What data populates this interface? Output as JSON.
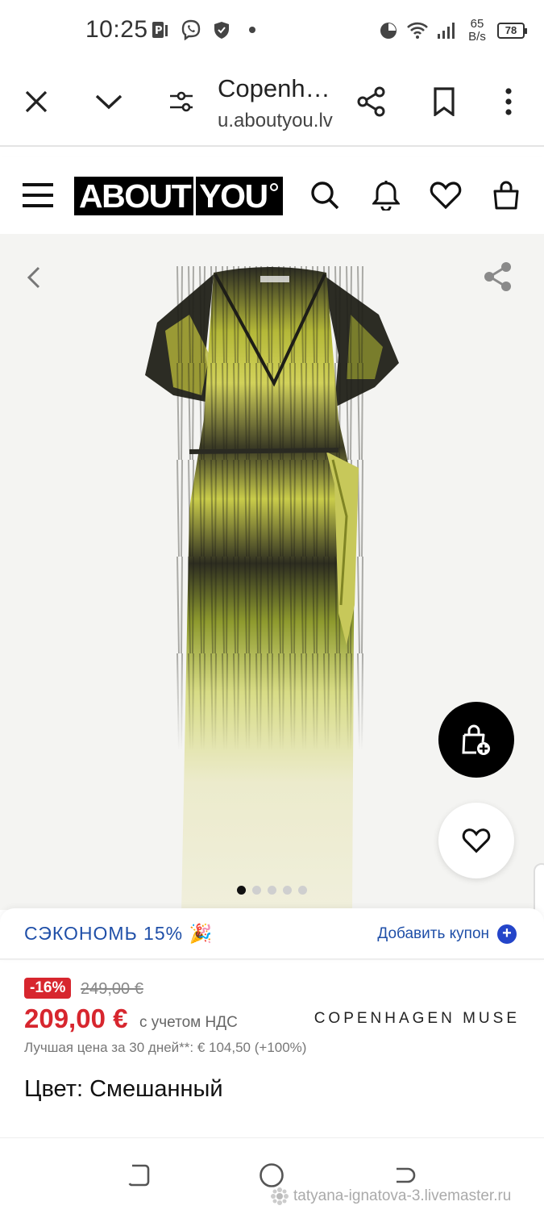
{
  "status_bar": {
    "time": "10:25",
    "net_speed_value": "65",
    "net_speed_unit": "B/s",
    "battery": "78",
    "icons": [
      "parking-icon",
      "viber-icon",
      "shield-icon",
      "dot-icon",
      "timer-icon",
      "wifi-icon",
      "signal-icon",
      "battery-icon"
    ]
  },
  "browser": {
    "title": "Copenh…",
    "url": "u.aboutyou.lv",
    "icons": [
      "close-icon",
      "chevron-down-icon",
      "tune-icon",
      "share-icon",
      "bookmark-icon",
      "more-vert-icon"
    ]
  },
  "site_header": {
    "logo_left": "ABOUT",
    "logo_right": "YOU",
    "icons": [
      "menu-icon",
      "search-icon",
      "bell-icon",
      "heart-icon",
      "bag-icon"
    ]
  },
  "gallery": {
    "image_count": 5,
    "active_index": 0,
    "icons": [
      "chevron-left-icon",
      "share-icon",
      "bag-plus-icon",
      "heart-icon"
    ]
  },
  "coupon": {
    "save_text": "СЭКОНОМЬ 15% 🎉",
    "add_label": "Добавить купон",
    "plus": "+"
  },
  "product": {
    "discount": "-16%",
    "old_price": "249,00 €",
    "price": "209,00 €",
    "vat_note": "с учетом НДС",
    "brand": "COPENHAGEN MUSE",
    "best_price": "Лучшая цена за 30 дней**: € 104,50 (+100%)",
    "color": "Цвет: Смешанный"
  },
  "nav_bar": {
    "icons": [
      "recent-apps-icon",
      "home-icon",
      "back-icon"
    ]
  },
  "watermark": "tatyana-ignatova-3.livemaster.ru",
  "colors": {
    "accent_red": "#d7262e",
    "link_blue": "#1f4fa8",
    "brand_black": "#000000"
  }
}
